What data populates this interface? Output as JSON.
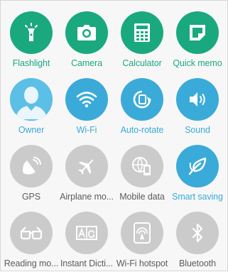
{
  "colors": {
    "green": "#1aa97f",
    "blue": "#3aaad9",
    "grey": "#cbcbcb",
    "grey_label": "#5c5c5c"
  },
  "tiles": [
    {
      "label": "Flashlight",
      "icon": "flashlight-icon",
      "state": "green"
    },
    {
      "label": "Camera",
      "icon": "camera-icon",
      "state": "green"
    },
    {
      "label": "Calculator",
      "icon": "calculator-icon",
      "state": "green"
    },
    {
      "label": "Quick memo",
      "icon": "quick-memo-icon",
      "state": "green"
    },
    {
      "label": "Owner",
      "icon": "owner-avatar-icon",
      "state": "blue"
    },
    {
      "label": "Wi-Fi",
      "icon": "wifi-icon",
      "state": "blue"
    },
    {
      "label": "Auto-rotate",
      "icon": "auto-rotate-icon",
      "state": "blue"
    },
    {
      "label": "Sound",
      "icon": "sound-icon",
      "state": "blue"
    },
    {
      "label": "GPS",
      "icon": "gps-icon",
      "state": "grey"
    },
    {
      "label": "Airplane mo...",
      "icon": "airplane-icon",
      "state": "grey"
    },
    {
      "label": "Mobile data",
      "icon": "mobile-data-icon",
      "state": "grey"
    },
    {
      "label": "Smart saving",
      "icon": "smart-saving-leaf-icon",
      "state": "blue"
    },
    {
      "label": "Reading mo...",
      "icon": "reading-glasses-icon",
      "state": "grey"
    },
    {
      "label": "Instant Dicti...",
      "icon": "instant-dictionary-icon",
      "state": "grey"
    },
    {
      "label": "Wi-Fi hotspot",
      "icon": "wifi-hotspot-icon",
      "state": "grey"
    },
    {
      "label": "Bluetooth",
      "icon": "bluetooth-icon",
      "state": "grey"
    }
  ]
}
